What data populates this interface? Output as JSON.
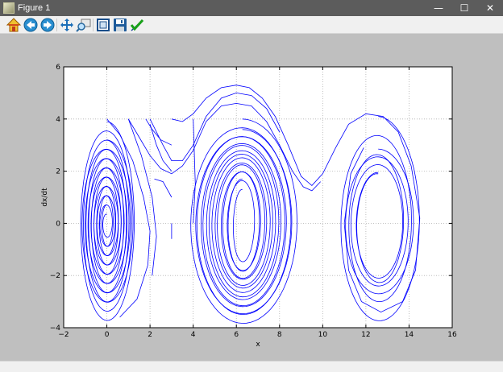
{
  "window": {
    "title": "Figure 1",
    "minimize_glyph": "—",
    "maximize_glyph": "☐",
    "close_glyph": "✕"
  },
  "toolbar": {
    "buttons": [
      {
        "name": "home-icon",
        "tooltip": "Reset original view"
      },
      {
        "name": "back-arrow-icon",
        "tooltip": "Back"
      },
      {
        "name": "forward-arrow-icon",
        "tooltip": "Forward"
      },
      {
        "name": "pan-move-icon",
        "tooltip": "Pan"
      },
      {
        "name": "zoom-rect-icon",
        "tooltip": "Zoom"
      },
      {
        "name": "configure-subplots-icon",
        "tooltip": "Configure subplots"
      },
      {
        "name": "save-disk-icon",
        "tooltip": "Save"
      },
      {
        "name": "edit-check-icon",
        "tooltip": "Edit curves"
      }
    ]
  },
  "colors": {
    "line": "#0000ff",
    "figure_bg": "#bfbfbf",
    "axes_bg": "#ffffff",
    "grid": "#b0b0b0"
  },
  "chart_data": {
    "type": "line",
    "title": "",
    "xlabel": "x",
    "ylabel": "dx/dt",
    "xlim": [
      -2,
      16
    ],
    "ylim": [
      -4,
      6
    ],
    "xticks": [
      -2,
      0,
      2,
      4,
      6,
      8,
      10,
      12,
      14,
      16
    ],
    "yticks": [
      -4,
      -2,
      0,
      2,
      4,
      6
    ],
    "xtick_labels": [
      "−2",
      "0",
      "2",
      "4",
      "6",
      "8",
      "10",
      "12",
      "14",
      "16"
    ],
    "ytick_labels": [
      "−4",
      "−2",
      "0",
      "2",
      "4",
      "6"
    ],
    "grid": true,
    "grid_style": "dotted",
    "legend": "none",
    "series_description": "Phase-plane trajectories of a damped pendulum spiralling in toward equilibria at x = 0, 2π and 4π",
    "series": [
      {
        "kind": "spiral",
        "x0": 0.0,
        "y0": 0.0,
        "x_radius": 1.25,
        "y_radius": 3.2,
        "turns": 8,
        "decay": 0.22,
        "width_start": 1.25,
        "width_end": 0.15,
        "height_start": 3.2,
        "height_end": 0.35
      },
      {
        "kind": "spiral",
        "x0": 0.0,
        "y0": 0.0,
        "x_radius": 1.2,
        "y_radius": 3.9,
        "turns": 9,
        "decay": 0.16,
        "width_start": 1.3,
        "width_end": 0.2,
        "height_start": 3.9,
        "height_end": 0.7
      },
      {
        "kind": "spiral",
        "x0": 6.28,
        "y0": 0.0,
        "x_radius": 2.5,
        "y_radius": 4.0,
        "turns": 8,
        "decay": 0.18,
        "width_start": 2.6,
        "width_end": 0.35,
        "height_start": 4.0,
        "height_end": 1.3
      },
      {
        "kind": "spiral",
        "x0": 6.28,
        "y0": 0.0,
        "x_radius": 2.3,
        "y_radius": 3.5,
        "turns": 7,
        "decay": 0.2,
        "width_start": 2.35,
        "width_end": 0.6,
        "height_start": 3.6,
        "height_end": 1.7
      },
      {
        "kind": "spiral",
        "x0": 12.57,
        "y0": 0.0,
        "x_radius": 2.0,
        "y_radius": 4.1,
        "turns": 3,
        "decay": 0.38,
        "width_start": 2.0,
        "width_end": 0.9,
        "height_start": 4.1,
        "height_end": 1.9
      },
      {
        "kind": "spiral",
        "x0": 12.57,
        "y0": 0.0,
        "x_radius": 1.7,
        "y_radius": 3.0,
        "turns": 3,
        "decay": 0.3,
        "width_start": 1.7,
        "width_end": 0.95,
        "height_start": 2.85,
        "height_end": 1.95
      },
      {
        "kind": "path",
        "points": [
          [
            3.0,
            4.0
          ],
          [
            3.5,
            3.9
          ],
          [
            4.0,
            4.2
          ],
          [
            4.6,
            4.8
          ],
          [
            5.3,
            5.2
          ],
          [
            6.0,
            5.3
          ],
          [
            6.6,
            5.2
          ],
          [
            7.2,
            4.8
          ],
          [
            7.8,
            4.1
          ],
          [
            8.4,
            3.0
          ],
          [
            9.0,
            1.8
          ],
          [
            9.5,
            1.45
          ],
          [
            10.0,
            1.9
          ],
          [
            10.6,
            2.9
          ],
          [
            11.2,
            3.8
          ],
          [
            12.0,
            4.2
          ],
          [
            12.8,
            4.1
          ],
          [
            13.5,
            3.5
          ],
          [
            14.1,
            2.2
          ],
          [
            14.5,
            0.2
          ],
          [
            14.3,
            -1.8
          ],
          [
            13.7,
            -3.0
          ],
          [
            12.7,
            -3.4
          ],
          [
            11.8,
            -3.0
          ],
          [
            11.2,
            -1.8
          ],
          [
            11.0,
            0.0
          ],
          [
            11.3,
            1.9
          ],
          [
            11.9,
            2.9
          ]
        ]
      },
      {
        "kind": "path",
        "points": [
          [
            1.0,
            4.0
          ],
          [
            1.5,
            3.3
          ],
          [
            2.0,
            2.6
          ],
          [
            2.5,
            2.1
          ],
          [
            3.0,
            1.9
          ],
          [
            3.5,
            2.2
          ],
          [
            4.0,
            2.8
          ],
          [
            4.6,
            3.9
          ],
          [
            5.3,
            4.5
          ],
          [
            6.0,
            4.6
          ],
          [
            6.7,
            4.5
          ],
          [
            7.4,
            3.9
          ],
          [
            8.0,
            3.0
          ],
          [
            8.6,
            2.0
          ],
          [
            9.1,
            1.4
          ],
          [
            9.5,
            1.25
          ],
          [
            9.9,
            1.6
          ]
        ]
      },
      {
        "kind": "path",
        "points": [
          [
            2.0,
            4.0
          ],
          [
            2.6,
            3.0
          ],
          [
            3.0,
            2.4
          ],
          [
            3.5,
            2.4
          ],
          [
            4.0,
            3.0
          ],
          [
            4.6,
            4.1
          ],
          [
            5.3,
            4.8
          ],
          [
            6.0,
            5.0
          ],
          [
            6.7,
            4.9
          ],
          [
            7.4,
            4.4
          ],
          [
            8.0,
            3.5
          ]
        ]
      },
      {
        "kind": "path",
        "points": [
          [
            0.0,
            4.0
          ],
          [
            0.6,
            3.4
          ],
          [
            1.2,
            2.4
          ],
          [
            1.7,
            1.0
          ],
          [
            2.0,
            -0.3
          ],
          [
            1.9,
            -1.6
          ],
          [
            1.4,
            -2.9
          ],
          [
            0.6,
            -3.6
          ]
        ]
      },
      {
        "kind": "path",
        "points": [
          [
            1.0,
            4.0
          ],
          [
            1.6,
            2.6
          ],
          [
            2.1,
            1.0
          ],
          [
            2.3,
            -0.5
          ],
          [
            2.1,
            -2.0
          ]
        ]
      },
      {
        "kind": "path",
        "points": [
          [
            3.0,
            1.0
          ],
          [
            2.6,
            1.6
          ],
          [
            2.2,
            1.7
          ]
        ]
      },
      {
        "kind": "path",
        "points": [
          [
            3.0,
            2.0
          ],
          [
            2.6,
            2.4
          ],
          [
            2.3,
            3.0
          ],
          [
            2.0,
            3.8
          ]
        ]
      },
      {
        "kind": "path",
        "points": [
          [
            3.0,
            3.0
          ],
          [
            2.5,
            3.2
          ],
          [
            2.1,
            3.6
          ],
          [
            1.8,
            4.0
          ]
        ]
      },
      {
        "kind": "path",
        "points": [
          [
            4.0,
            4.0
          ],
          [
            4.1,
            1.5
          ],
          [
            4.0,
            0.0
          ]
        ]
      },
      {
        "kind": "path",
        "points": [
          [
            3.0,
            0.0
          ],
          [
            3.0,
            -0.6
          ]
        ]
      }
    ]
  }
}
